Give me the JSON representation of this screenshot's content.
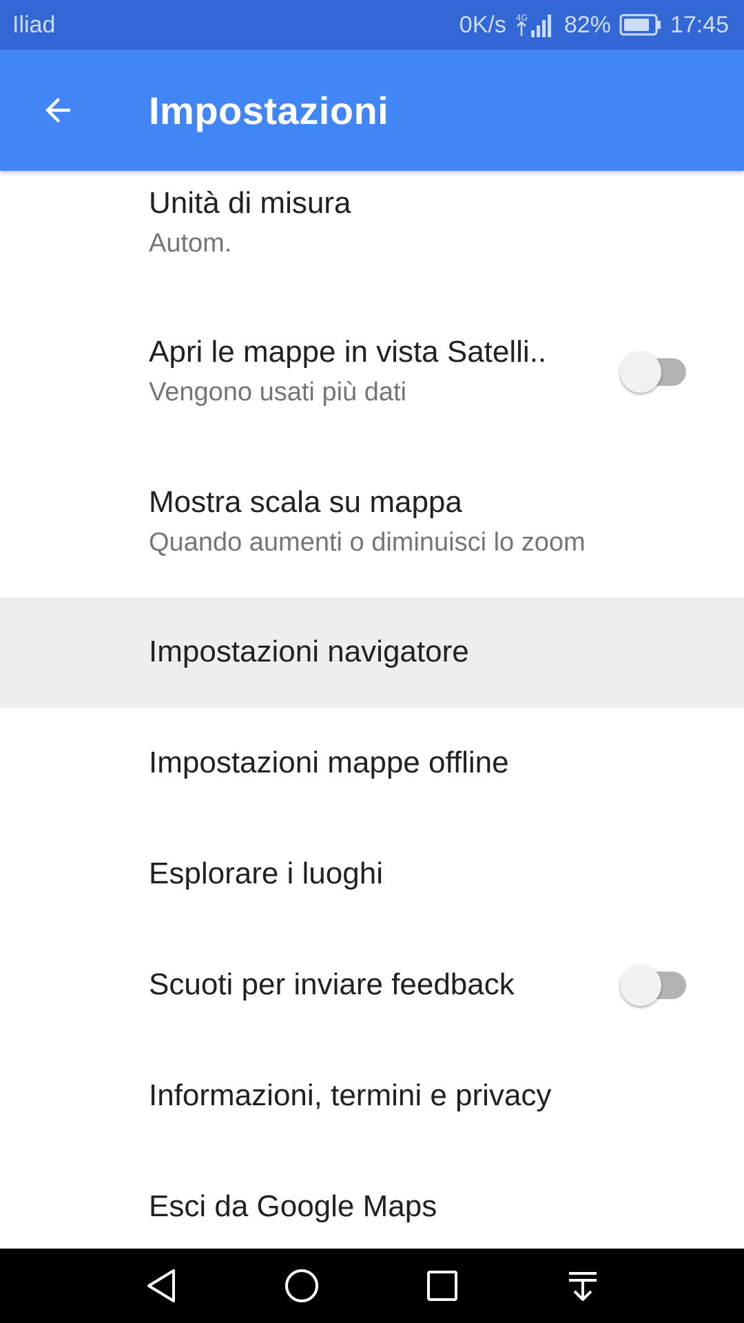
{
  "status_bar": {
    "carrier": "Iliad",
    "speed": "0K/s",
    "battery_percent": "82%",
    "time": "17:45"
  },
  "app_bar": {
    "title": "Impostazioni",
    "back_icon": "arrow-back-icon"
  },
  "settings": [
    {
      "title": "Unità di misura",
      "subtitle": "Autom."
    },
    {
      "title": "Apri le mappe in vista Satelli..",
      "subtitle": "Vengono usati più dati",
      "toggle": false
    },
    {
      "title": "Mostra scala su mappa",
      "subtitle": "Quando aumenti o diminuisci lo zoom"
    },
    {
      "title": "Impostazioni navigatore"
    },
    {
      "title": "Impostazioni mappe offline"
    },
    {
      "title": "Esplorare i luoghi"
    },
    {
      "title": "Scuoti per inviare feedback",
      "toggle": false
    },
    {
      "title": "Informazioni, termini e privacy"
    },
    {
      "title": "Esci da Google Maps"
    }
  ],
  "nav_bar": {
    "icons": [
      "back-triangle-icon",
      "home-circle-icon",
      "recents-square-icon",
      "notification-pull-icon"
    ]
  },
  "colors": {
    "status_bar": "#3367d6",
    "app_bar": "#4285f4",
    "pressed_row": "#eeeeee"
  }
}
